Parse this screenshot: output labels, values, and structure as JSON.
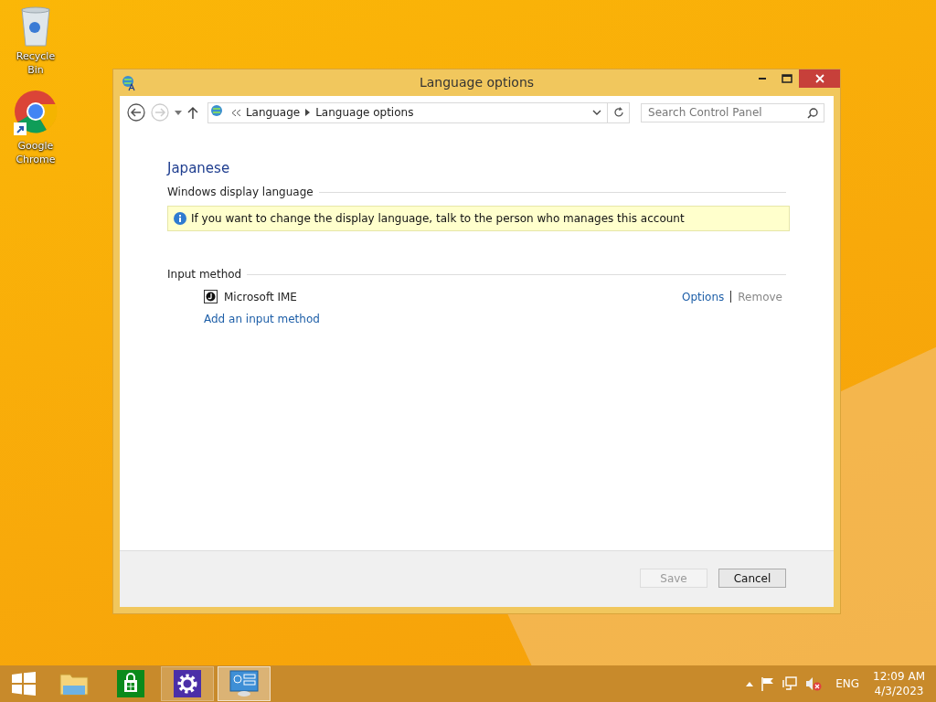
{
  "desktop_icons": [
    {
      "kind": "bin",
      "label": "Recycle Bin"
    },
    {
      "kind": "chrome",
      "label": "Google Chrome"
    }
  ],
  "window": {
    "title": "Language options",
    "nav": {
      "back_disabled": false,
      "forward_disabled": true
    },
    "breadcrumb": [
      "Language",
      "Language options"
    ],
    "search": {
      "placeholder": "Search Control Panel"
    },
    "heading": "Japanese",
    "display_section": {
      "title": "Windows display language",
      "info": "If you want to change the display language, talk to the person who manages this account"
    },
    "input_section": {
      "title": "Input method",
      "methods": [
        {
          "name": "Microsoft IME",
          "links": [
            {
              "label": "Options",
              "disabled": false
            },
            {
              "label": "Remove",
              "disabled": true
            }
          ]
        }
      ],
      "add_link": "Add an input method"
    },
    "buttons": [
      {
        "label": "Save",
        "disabled": true
      },
      {
        "label": "Cancel",
        "disabled": false
      }
    ]
  },
  "taskbar": {
    "apps": [
      {
        "kind": "explorer",
        "open": false,
        "selected": false
      },
      {
        "kind": "store",
        "open": false,
        "selected": false
      },
      {
        "kind": "settings",
        "open": true,
        "selected": false
      },
      {
        "kind": "control-panel",
        "open": true,
        "selected": true
      }
    ],
    "language": "ENG",
    "time": "12:09 AM",
    "date": "4/3/2023"
  }
}
